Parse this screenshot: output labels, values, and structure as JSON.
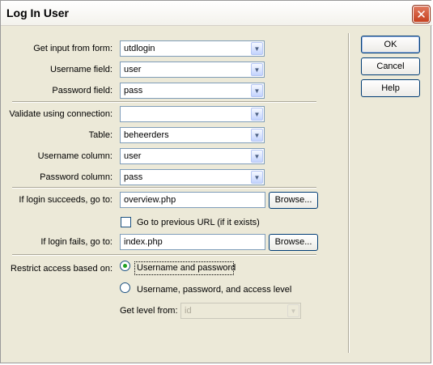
{
  "window": {
    "title": "Log In User"
  },
  "form": {
    "get_input_label": "Get input from form:",
    "get_input_value": "utdlogin",
    "username_field_label": "Username field:",
    "username_field_value": "user",
    "password_field_label": "Password field:",
    "password_field_value": "pass",
    "validate_label": "Validate using connection:",
    "validate_value": "",
    "table_label": "Table:",
    "table_value": "beheerders",
    "username_column_label": "Username column:",
    "username_column_value": "user",
    "password_column_label": "Password column:",
    "password_column_value": "pass",
    "success_label": "If login succeeds, go to:",
    "success_value": "overview.php",
    "previous_url_label": "Go to previous URL (if it exists)",
    "previous_url_checked": false,
    "fail_label": "If login fails, go to:",
    "fail_value": "index.php",
    "browse_label": "Browse...",
    "restrict_label": "Restrict access based on:",
    "restrict_options": [
      "Username and password",
      "Username, password, and access level"
    ],
    "restrict_selected": "Username and password",
    "level_label": "Get level from:",
    "level_value": "id"
  },
  "buttons": {
    "ok": "OK",
    "cancel": "Cancel",
    "help": "Help"
  },
  "colors": {
    "radio_selected": "#21a121",
    "close_button": "#c6401f",
    "dialog_bg": "#ece9d8"
  }
}
